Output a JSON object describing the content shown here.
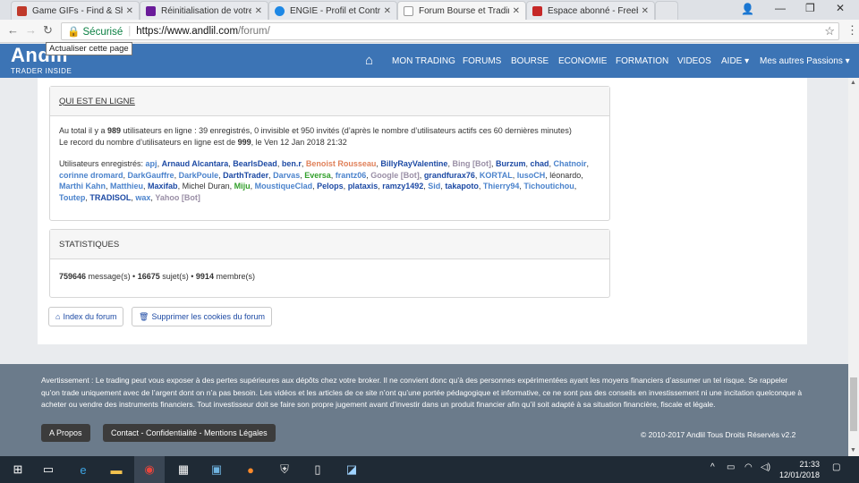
{
  "browser": {
    "tabs": [
      {
        "title": "Game GIFs - Find & Shar",
        "fav_color": "#c0392b"
      },
      {
        "title": "Réinitialisation de votre m",
        "fav_color": "#6a1b9a"
      },
      {
        "title": "ENGIE - Profil et Contrats",
        "fav_color": "#1e88e5"
      },
      {
        "title": "Forum Bourse et Trading",
        "fav_color": "#e0e0e0"
      },
      {
        "title": "Espace abonné - Freebox",
        "fav_color": "#c62828"
      }
    ],
    "secure_label": "Sécurisé",
    "url_host": "https://www.andlil.com",
    "url_path": "/forum/",
    "tooltip": "Actualiser cette page"
  },
  "site": {
    "logo": "Andlil",
    "logo_sub": "TRADER INSIDE",
    "nav": [
      "MON TRADING",
      "FORUMS",
      "BOURSE",
      "ECONOMIE",
      "FORMATION",
      "VIDEOS",
      "AIDE ▾",
      "Mes autres Passions ▾"
    ]
  },
  "online": {
    "title": "QUI EST EN LIGNE",
    "line1_a": "Au total il y a ",
    "line1_total": "989",
    "line1_b": " utilisateurs en ligne : 39 enregistrés, 0 invisible et 950 invités (d’après le nombre d’utilisateurs actifs ces 60 dernières minutes)",
    "line2_a": "Le record du nombre d’utilisateurs en ligne est de ",
    "line2_record": "999",
    "line2_b": ", le Ven 12 Jan 2018 21:32",
    "users_label": "Utilisateurs enregistrés: ",
    "users": [
      {
        "name": "apj",
        "color": "#4b83cc",
        "bold": true
      },
      {
        "name": "Arnaud Alcantara",
        "color": "#1d4aa4",
        "bold": true
      },
      {
        "name": "BearIsDead",
        "color": "#1d4aa4",
        "bold": true
      },
      {
        "name": "ben.r",
        "color": "#1d4aa4",
        "bold": true
      },
      {
        "name": "Benoist Rousseau",
        "color": "#e0815a",
        "bold": true
      },
      {
        "name": "BillyRayValentine",
        "color": "#1d4aa4",
        "bold": true
      },
      {
        "name": "Bing [Bot]",
        "color": "#9a8fa6",
        "bold": true
      },
      {
        "name": "Burzum",
        "color": "#1d4aa4",
        "bold": true
      },
      {
        "name": "chad",
        "color": "#1d4aa4",
        "bold": true
      },
      {
        "name": "Chatnoir",
        "color": "#4b83cc",
        "bold": true
      },
      {
        "name": "corinne dromard",
        "color": "#4b83cc",
        "bold": true
      },
      {
        "name": "DarkGauffre",
        "color": "#4b83cc",
        "bold": true
      },
      {
        "name": "DarkPoule",
        "color": "#4b83cc",
        "bold": true
      },
      {
        "name": "DarthTrader",
        "color": "#1d4aa4",
        "bold": true
      },
      {
        "name": "Darvas",
        "color": "#4b83cc",
        "bold": true
      },
      {
        "name": "Eversa",
        "color": "#33a02c",
        "bold": true
      },
      {
        "name": "frantz06",
        "color": "#4b83cc",
        "bold": true
      },
      {
        "name": "Google [Bot]",
        "color": "#9a8fa6",
        "bold": true
      },
      {
        "name": "grandfurax76",
        "color": "#1d4aa4",
        "bold": true
      },
      {
        "name": "KORTAL",
        "color": "#4b83cc",
        "bold": true
      },
      {
        "name": "lusoCH",
        "color": "#4b83cc",
        "bold": true
      },
      {
        "name": "léonardo",
        "color": "#333333",
        "bold": false
      },
      {
        "name": "Marthi Kahn",
        "color": "#4b83cc",
        "bold": true
      },
      {
        "name": "Matthieu",
        "color": "#4b83cc",
        "bold": true
      },
      {
        "name": "Maxifab",
        "color": "#1d4aa4",
        "bold": true
      },
      {
        "name": "Michel Duran",
        "color": "#333333",
        "bold": false
      },
      {
        "name": "Miju",
        "color": "#33a02c",
        "bold": true
      },
      {
        "name": "MoustiqueClad",
        "color": "#4b83cc",
        "bold": true
      },
      {
        "name": "Pelops",
        "color": "#1d4aa4",
        "bold": true
      },
      {
        "name": "plataxis",
        "color": "#1d4aa4",
        "bold": true
      },
      {
        "name": "ramzy1492",
        "color": "#1d4aa4",
        "bold": true
      },
      {
        "name": "Sid",
        "color": "#4b83cc",
        "bold": true
      },
      {
        "name": "takapoto",
        "color": "#1d4aa4",
        "bold": true
      },
      {
        "name": "Thierry94",
        "color": "#4b83cc",
        "bold": true
      },
      {
        "name": "Tichoutichou",
        "color": "#4b83cc",
        "bold": true
      },
      {
        "name": "Toutep",
        "color": "#4b83cc",
        "bold": true
      },
      {
        "name": "TRADISOL",
        "color": "#1d4aa4",
        "bold": true
      },
      {
        "name": "wax",
        "color": "#4b83cc",
        "bold": true
      },
      {
        "name": "Yahoo [Bot]",
        "color": "#9a8fa6",
        "bold": true
      }
    ]
  },
  "stats": {
    "title": "STATISTIQUES",
    "messages": "759646",
    "messages_label": " message(s) • ",
    "topics": "16675",
    "topics_label": " sujet(s) • ",
    "members": "9914",
    "members_label": " membre(s)"
  },
  "buttons": {
    "index": "Index du forum",
    "cookies": "Supprimer les cookies du forum"
  },
  "footer": {
    "warning": "Avertissement : Le trading peut vous exposer à des pertes supérieures aux dépôts chez votre broker. Il ne convient donc qu’à des personnes expérimentées ayant les moyens financiers d’assumer un tel risque. Se rappeler qu’on trade uniquement avec de l’argent dont on n’a pas besoin. Les vidéos et les articles de ce site n’ont qu’une portée pédagogique et informative, ce ne sont pas des conseils en investissement ni une incitation quelconque à acheter ou vendre des instruments financiers. Tout investisseur doit se faire son propre jugement avant d’investir dans un produit financier afin qu’il soit adapté à sa situation financière, fiscale et légale.",
    "apropos": "A Propos",
    "contact": "Contact - Confidentialité - Mentions Légales",
    "copyright": "© 2010-2017 Andlil Tous Droits Réservés v2.2"
  },
  "taskbar": {
    "time": "21:33",
    "date": "12/01/2018"
  }
}
